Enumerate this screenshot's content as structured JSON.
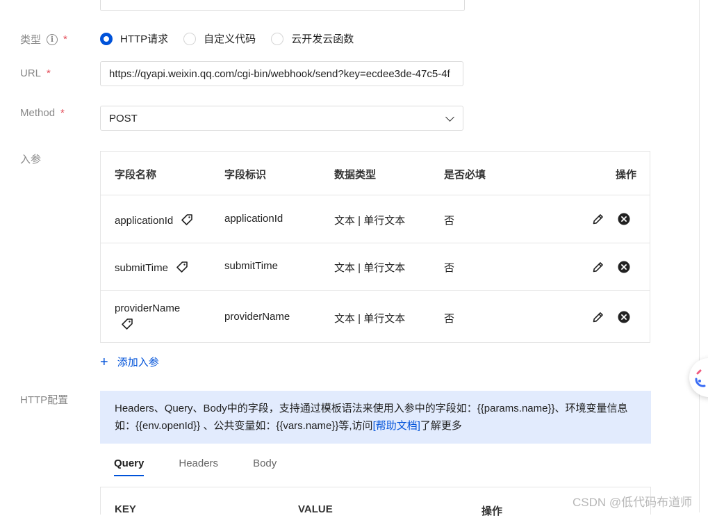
{
  "form": {
    "type": {
      "label": "类型",
      "required_mark": "*",
      "options": [
        "HTTP请求",
        "自定义代码",
        "云开发云函数"
      ],
      "selected": "HTTP请求"
    },
    "url": {
      "label": "URL",
      "required_mark": "*",
      "value": "https://qyapi.weixin.qq.com/cgi-bin/webhook/send?key=ecdee3de-47c5-4f"
    },
    "method": {
      "label": "Method",
      "required_mark": "*",
      "value": "POST"
    },
    "params": {
      "label": "入参",
      "headers": [
        "字段名称",
        "字段标识",
        "数据类型",
        "是否必填",
        "操作"
      ],
      "rows": [
        {
          "name": "applicationId",
          "key": "applicationId",
          "type": "文本 | 单行文本",
          "required": "否"
        },
        {
          "name": "submitTime",
          "key": "submitTime",
          "type": "文本 | 单行文本",
          "required": "否"
        },
        {
          "name": "providerName",
          "key": "providerName",
          "type": "文本 | 单行文本",
          "required": "否"
        }
      ],
      "add_label": "添加入参"
    },
    "http_config": {
      "label": "HTTP配置",
      "notice_before": "Headers、Query、Body中的字段，支持通过模板语法来使用入参中的字段如：{{params.name}}、环境变量信息如：{{env.openId}} 、公共变量如：{{vars.name}}等,访问",
      "help_link": "[帮助文档]",
      "notice_after": "了解更多",
      "tabs": [
        "Query",
        "Headers",
        "Body"
      ],
      "active_tab": "Query",
      "query_headers": [
        "KEY",
        "VALUE",
        "操作"
      ]
    }
  },
  "icons": {
    "info": "info-circle-icon",
    "tag": "tag-icon",
    "edit": "pencil-icon",
    "delete": "close-circle-icon",
    "add": "plus-icon"
  },
  "colors": {
    "primary": "#0052d9",
    "required": "#e34d59",
    "notice_bg": "#e2ebfd"
  },
  "watermark": "CSDN @低代码布道师"
}
